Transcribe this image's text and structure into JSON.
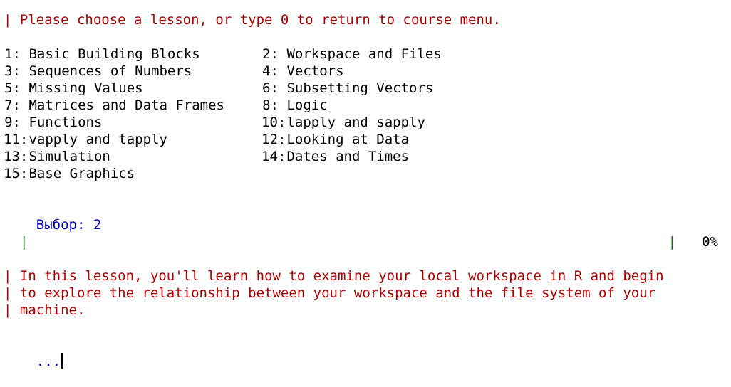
{
  "prompt_text": "| Please choose a lesson, or type 0 to return to course menu.",
  "lessons": [
    {
      "left_num": "1:",
      "left_label": "Basic Building Blocks",
      "right_num": "2:",
      "right_label": "Workspace and Files"
    },
    {
      "left_num": "3:",
      "left_label": "Sequences of Numbers",
      "right_num": "4:",
      "right_label": "Vectors"
    },
    {
      "left_num": "5:",
      "left_label": "Missing Values",
      "right_num": "6:",
      "right_label": "Subsetting Vectors"
    },
    {
      "left_num": "7:",
      "left_label": "Matrices and Data Frames",
      "right_num": "8:",
      "right_label": "Logic"
    },
    {
      "left_num": "9:",
      "left_label": "Functions",
      "right_num": "10:",
      "right_label": "lapply and sapply"
    },
    {
      "left_num": "11:",
      "left_label": "vapply and tapply",
      "right_num": "12:",
      "right_label": "Looking at Data"
    },
    {
      "left_num": "13:",
      "left_label": "Simulation",
      "right_num": "14:",
      "right_label": "Dates and Times"
    },
    {
      "left_num": "15:",
      "left_label": "Base Graphics",
      "right_num": "",
      "right_label": ""
    }
  ],
  "selection": {
    "label": "Выбор:",
    "value": "2"
  },
  "progress": {
    "left_pipe": "|",
    "right_pipe": "|",
    "percent_text": "0%",
    "fraction": 0.0
  },
  "lesson_intro": [
    "| In this lesson, you'll learn how to examine your local workspace in R and begin",
    "| to explore the relationship between your workspace and the file system of your",
    "| machine."
  ],
  "continue_prompt": "...",
  "colors": {
    "message_red": "#b00000",
    "input_blue": "#0000cc",
    "progress_green": "#1a7a1a"
  }
}
